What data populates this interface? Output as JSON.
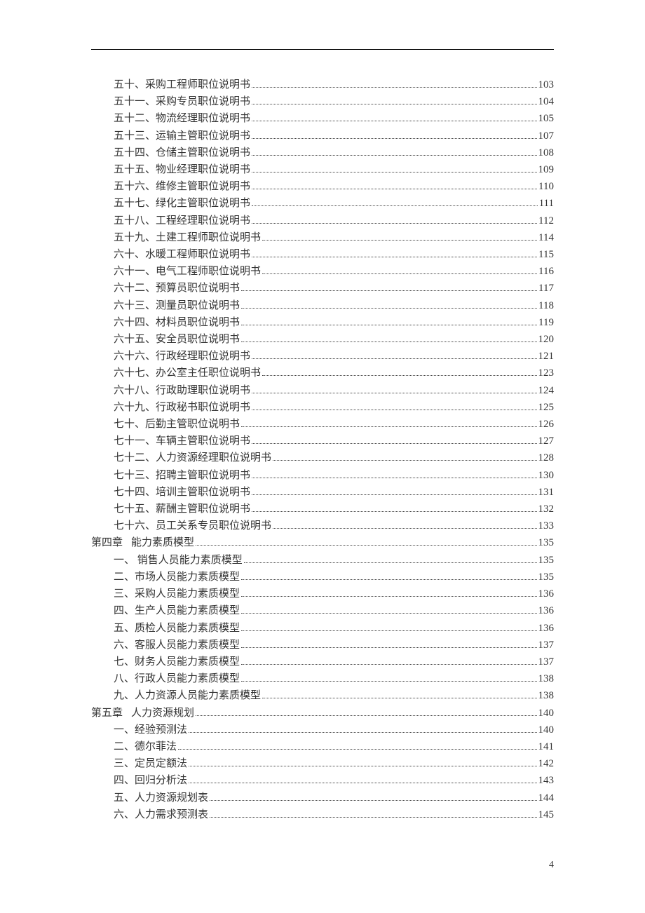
{
  "footer_page_number": "4",
  "toc": [
    {
      "indent": "sub",
      "title": "五十、采购工程师职位说明书",
      "page": "103"
    },
    {
      "indent": "sub",
      "title": "五十一、采购专员职位说明书",
      "page": "104"
    },
    {
      "indent": "sub",
      "title": "五十二、物流经理职位说明书",
      "page": "105"
    },
    {
      "indent": "sub",
      "title": "五十三、运输主管职位说明书",
      "page": "107"
    },
    {
      "indent": "sub",
      "title": "五十四、仓储主管职位说明书",
      "page": "108"
    },
    {
      "indent": "sub",
      "title": "五十五、物业经理职位说明书",
      "page": "109"
    },
    {
      "indent": "sub",
      "title": "五十六、维修主管职位说明书",
      "page": "110"
    },
    {
      "indent": "sub",
      "title": "五十七、绿化主管职位说明书",
      "page": "111"
    },
    {
      "indent": "sub",
      "title": "五十八、工程经理职位说明书",
      "page": "112"
    },
    {
      "indent": "sub",
      "title": "五十九、土建工程师职位说明书",
      "page": "114"
    },
    {
      "indent": "sub",
      "title": "六十、水暖工程师职位说明书",
      "page": "115"
    },
    {
      "indent": "sub",
      "title": "六十一、电气工程师职位说明书",
      "page": "116"
    },
    {
      "indent": "sub",
      "title": "六十二、预算员职位说明书",
      "page": "117"
    },
    {
      "indent": "sub",
      "title": "六十三、测量员职位说明书",
      "page": "118"
    },
    {
      "indent": "sub",
      "title": "六十四、材料员职位说明书",
      "page": "119"
    },
    {
      "indent": "sub",
      "title": "六十五、安全员职位说明书",
      "page": "120"
    },
    {
      "indent": "sub",
      "title": "六十六、行政经理职位说明书",
      "page": "121"
    },
    {
      "indent": "sub",
      "title": "六十七、办公室主任职位说明书",
      "page": "123"
    },
    {
      "indent": "sub",
      "title": "六十八、行政助理职位说明书",
      "page": "124"
    },
    {
      "indent": "sub",
      "title": "六十九、行政秘书职位说明书",
      "page": "125"
    },
    {
      "indent": "sub",
      "title": "七十、后勤主管职位说明书",
      "page": "126"
    },
    {
      "indent": "sub",
      "title": "七十一、车辆主管职位说明书",
      "page": "127"
    },
    {
      "indent": "sub",
      "title": "七十二、人力资源经理职位说明书",
      "page": "128"
    },
    {
      "indent": "sub",
      "title": "七十三、招聘主管职位说明书",
      "page": "130"
    },
    {
      "indent": "sub",
      "title": "七十四、培训主管职位说明书",
      "page": "131"
    },
    {
      "indent": "sub",
      "title": "七十五、薪酬主管职位说明书",
      "page": "132"
    },
    {
      "indent": "sub",
      "title": "七十六、员工关系专员职位说明书",
      "page": "133"
    },
    {
      "indent": "chapter",
      "chapter_label": "第四章",
      "title": "能力素质模型",
      "page": "135"
    },
    {
      "indent": "sub",
      "title": "一、 销售人员能力素质模型",
      "page": "135"
    },
    {
      "indent": "sub",
      "title": "二、市场人员能力素质模型",
      "page": "135"
    },
    {
      "indent": "sub",
      "title": "三、采购人员能力素质模型",
      "page": "136"
    },
    {
      "indent": "sub",
      "title": "四、生产人员能力素质模型",
      "page": "136"
    },
    {
      "indent": "sub",
      "title": "五、质检人员能力素质模型",
      "page": "136"
    },
    {
      "indent": "sub",
      "title": "六、客服人员能力素质模型",
      "page": "137"
    },
    {
      "indent": "sub",
      "title": "七、财务人员能力素质模型",
      "page": "137"
    },
    {
      "indent": "sub",
      "title": "八、行政人员能力素质模型",
      "page": "138"
    },
    {
      "indent": "sub",
      "title": "九、人力资源人员能力素质模型",
      "page": "138"
    },
    {
      "indent": "chapter",
      "chapter_label": "第五章",
      "title": "人力资源规划",
      "page": "140"
    },
    {
      "indent": "sub",
      "title": "一、经验预测法",
      "page": "140"
    },
    {
      "indent": "sub",
      "title": "二、德尔菲法",
      "page": "141"
    },
    {
      "indent": "sub",
      "title": "三、定员定额法",
      "page": "142"
    },
    {
      "indent": "sub",
      "title": "四、回归分析法",
      "page": "143"
    },
    {
      "indent": "sub",
      "title": "五、人力资源规划表",
      "page": "144"
    },
    {
      "indent": "sub",
      "title": "六、人力需求预测表",
      "page": "145"
    }
  ]
}
